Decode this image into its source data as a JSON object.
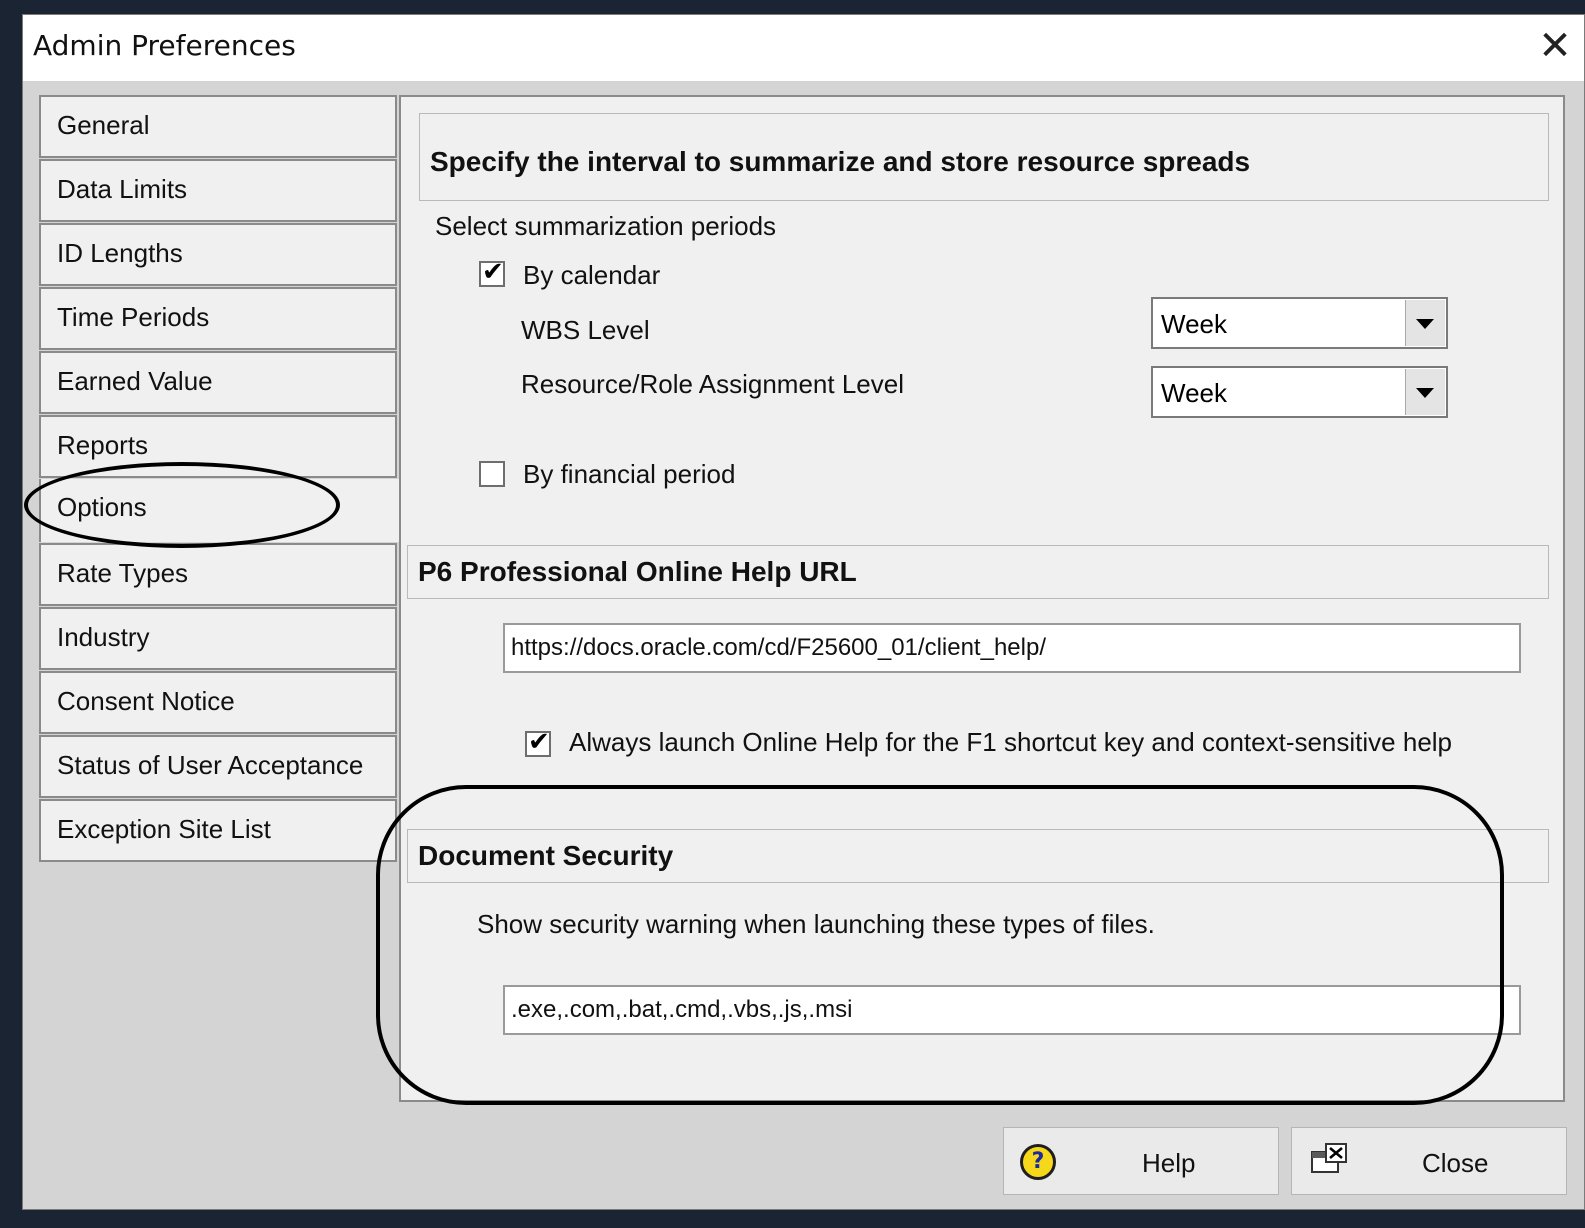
{
  "window": {
    "title": "Admin Preferences",
    "close_glyph": "✕"
  },
  "nav": {
    "items": [
      {
        "label": "General"
      },
      {
        "label": "Data Limits"
      },
      {
        "label": "ID Lengths"
      },
      {
        "label": "Time Periods"
      },
      {
        "label": "Earned Value"
      },
      {
        "label": "Reports"
      },
      {
        "label": "Options",
        "selected": true
      },
      {
        "label": "Rate Types"
      },
      {
        "label": "Industry"
      },
      {
        "label": "Consent Notice"
      },
      {
        "label": "Status of User Acceptance"
      },
      {
        "label": "Exception Site List"
      }
    ]
  },
  "summarize": {
    "header": "Specify the interval to summarize and store resource spreads",
    "periods_label": "Select summarization periods",
    "by_calendar": {
      "label": "By calendar",
      "checked": true
    },
    "wbs_level": {
      "label": "WBS Level",
      "value": "Week"
    },
    "resource_level": {
      "label": "Resource/Role Assignment Level",
      "value": "Week"
    },
    "by_financial": {
      "label": "By financial period",
      "checked": false
    }
  },
  "help_url": {
    "header": "P6 Professional Online Help URL",
    "url": "https://docs.oracle.com/cd/F25600_01/client_help/",
    "always_launch": {
      "label": "Always launch Online Help for the F1 shortcut key and context-sensitive help",
      "checked": true
    }
  },
  "doc_security": {
    "header": "Document Security",
    "description": "Show security warning when launching these types of files.",
    "extensions": ".exe,.com,.bat,.cmd,.vbs,.js,.msi"
  },
  "buttons": {
    "help": {
      "label": "Help",
      "icon": "help-icon"
    },
    "close": {
      "label": "Close",
      "icon": "close-window-icon"
    }
  },
  "colors": {
    "dialog_bg": "#d4d4d4",
    "panel_bg": "#f0f0f0",
    "annotation": "#000000"
  }
}
